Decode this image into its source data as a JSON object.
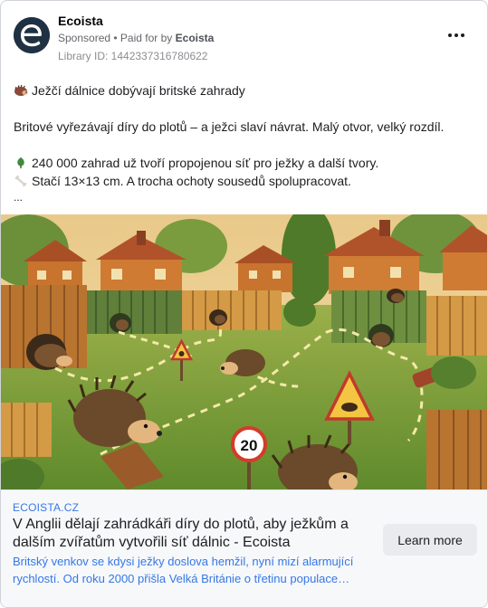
{
  "post": {
    "page_name": "Ecoista",
    "sponsored_label": "Sponsored",
    "separator": " • ",
    "paid_for_prefix": "Paid for by",
    "paid_for_name": "Ecoista",
    "library_id": "Library ID: 1442337316780622",
    "avatar_letter": "e",
    "more_icon": "more-horizontal-icon"
  },
  "body": {
    "line1": "Ježčí dálnice dobývají britské zahrady",
    "line1_emoji": "hedgehog-icon",
    "line2": "Britové vyřezávají díry do plotů – a ježci slaví návrat. Malý otvor, velký rozdíl.",
    "line3": "240 000 zahrad už tvoří propojenou síť pro ježky a další tvory.",
    "line3_emoji": "tree-icon",
    "line4": "Stačí 13×13 cm. A trocha ochoty sousedů spolupracovat.",
    "line4_emoji": "bone-icon",
    "truncation": "..."
  },
  "image": {
    "sign_number": "20",
    "alt_icon": "garden-hedgehog-illustration"
  },
  "link": {
    "domain": "ECOISTA.CZ",
    "headline": "V Anglii dělají zahrádkáři díry do plotů, aby ježkům a dalším zvířatům vytvořili síť dálnic - Ecoista",
    "description": "Britský venkov se kdysi ježky doslova hemžil, nyní mizí alarmující rychlostí. Od roku 2000 přišla Velká Británie o třetinu populace…",
    "cta_label": "Learn more"
  },
  "colors": {
    "link_blue": "#3578e5",
    "avatar_bg": "#1f3142"
  }
}
